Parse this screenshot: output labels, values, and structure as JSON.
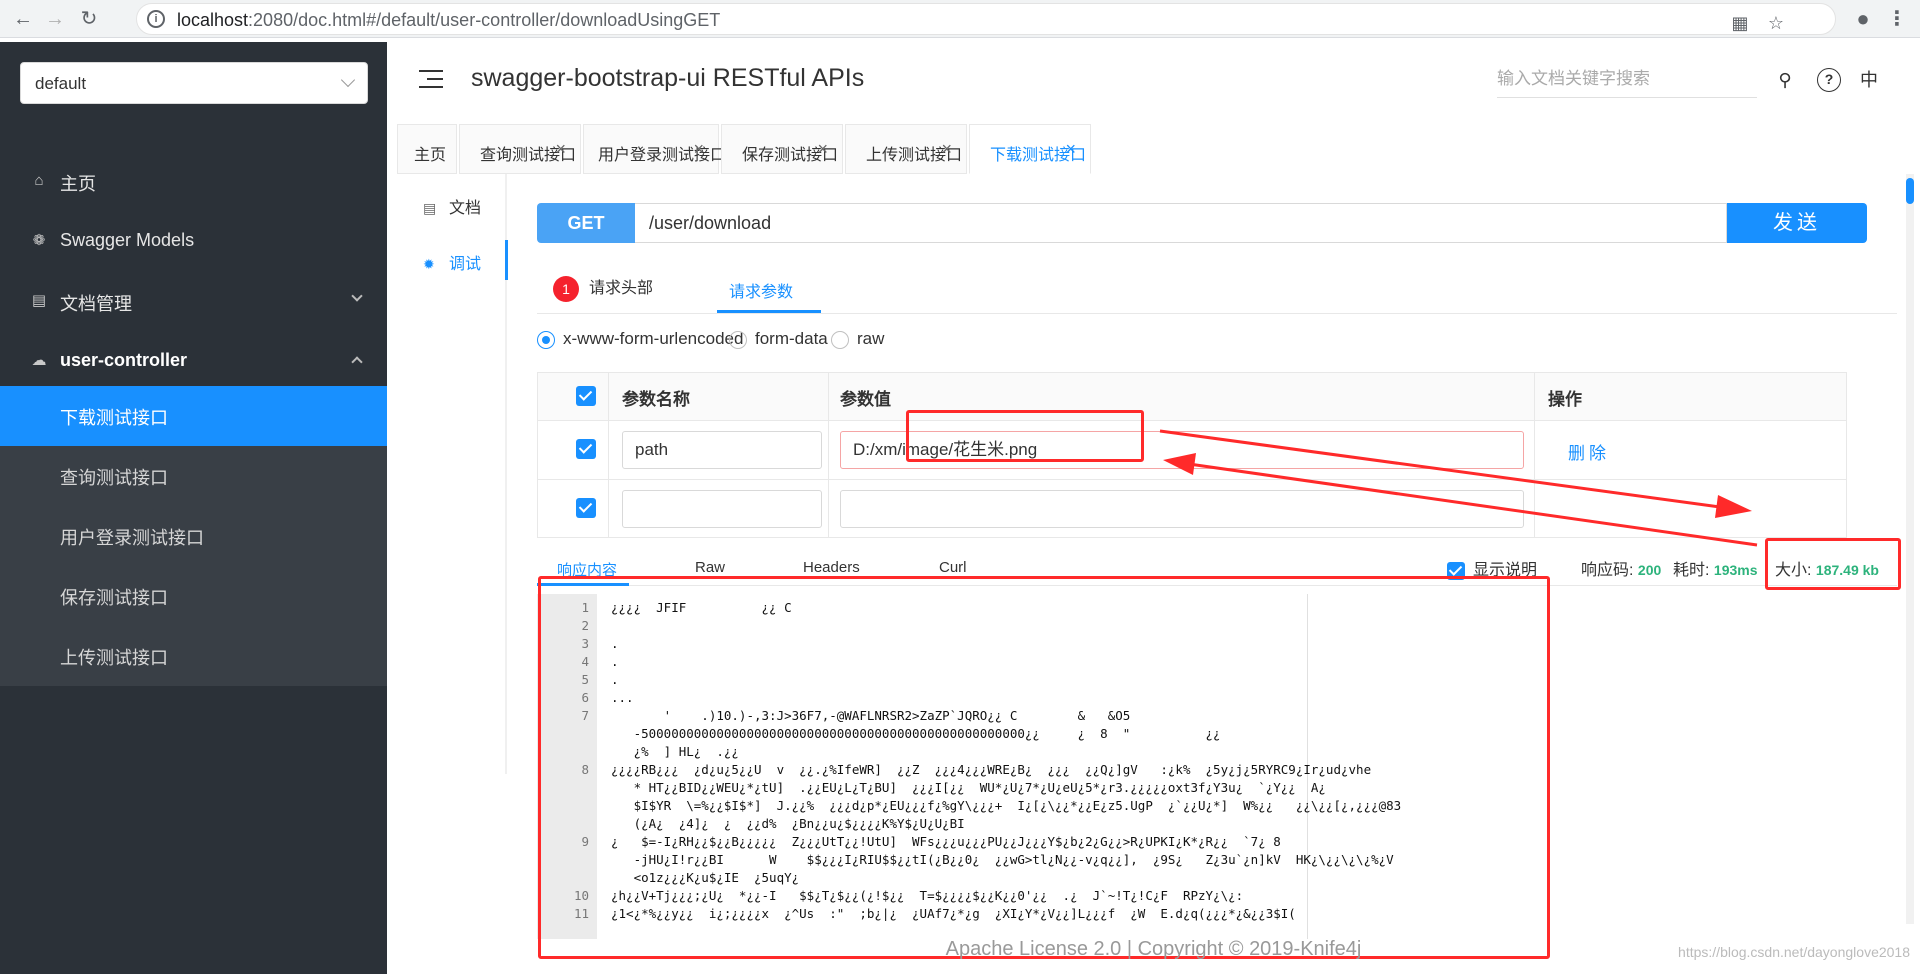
{
  "browser": {
    "url_host": "localhost",
    "url_rest": ":2080/doc.html#/default/user-controller/downloadUsingGET"
  },
  "sidebar": {
    "group_select": "default",
    "items": [
      {
        "label": "主页",
        "icon": "home-icon"
      },
      {
        "label": "Swagger Models",
        "icon": "models-icon"
      },
      {
        "label": "文档管理",
        "icon": "doc-manage-icon"
      },
      {
        "label": "user-controller",
        "icon": "cloud-icon"
      }
    ],
    "sub_items": [
      {
        "label": "下载测试接口",
        "active": true
      },
      {
        "label": "查询测试接口"
      },
      {
        "label": "用户登录测试接口"
      },
      {
        "label": "保存测试接口"
      },
      {
        "label": "上传测试接口"
      }
    ]
  },
  "header": {
    "title": "swagger-bootstrap-ui RESTful APIs",
    "search_placeholder": "输入文档关键字搜索",
    "lang": "中"
  },
  "tabs": [
    {
      "label": "主页"
    },
    {
      "label": "查询测试接口"
    },
    {
      "label": "用户登录测试接口"
    },
    {
      "label": "保存测试接口"
    },
    {
      "label": "上传测试接口"
    },
    {
      "label": "下载测试接口",
      "active": true
    }
  ],
  "doc_nav": {
    "doc": "文档",
    "debug": "调试"
  },
  "request": {
    "method": "GET",
    "url": "/user/download",
    "send": "发送",
    "header_tab": "请求头部",
    "header_count": "1",
    "params_tab": "请求参数",
    "content_types": [
      "x-www-form-urlencoded",
      "form-data",
      "raw"
    ],
    "table": {
      "col_name": "参数名称",
      "col_value": "参数值",
      "col_op": "操作",
      "rows": [
        {
          "name": "path",
          "value": "D:/xm/image/花生米.png",
          "op": "删除"
        },
        {
          "name": "",
          "value": "",
          "op": ""
        }
      ]
    }
  },
  "response": {
    "tabs": [
      "响应内容",
      "Raw",
      "Headers",
      "Curl"
    ],
    "show_desc": "显示说明",
    "code_label": "响应码:",
    "code": "200",
    "time_label": "耗时:",
    "time": "193ms",
    "size_label": "大小:",
    "size": "187.49 kb",
    "lines": [
      {
        "n": "1",
        "t": "¿¿¿¿  JFIF          ¿¿ C"
      },
      {
        "n": "2",
        "t": ""
      },
      {
        "n": "3",
        "t": "."
      },
      {
        "n": "4",
        "t": "."
      },
      {
        "n": "5",
        "t": "."
      },
      {
        "n": "6",
        "t": "..."
      },
      {
        "n": "7",
        "t": "       '    .)10.)-,3:J>36F7,-@WAFLNRSR2>ZaZP`JQRO¿¿ C        &   &O5"
      },
      {
        "n": "",
        "t": "   -500000000000000000000000000000000000000000000000000¿¿     ¿  8  \"          ¿¿"
      },
      {
        "n": "",
        "t": "   ¿%  ] HL¿  .¿¿"
      },
      {
        "n": "8",
        "t": "¿¿¿¿RB¿¿¿  ¿d¿u¿5¿¿U  v  ¿¿.¿%IfeWR]  ¿¿Z  ¿¿¿4¿¿¿WRE¿B¿  ¿¿¿  ¿¿Q¿]gV   :¿k%  ¿5y¿j¿5RYRC9¿Ir¿ud¿vhe"
      },
      {
        "n": "",
        "t": "   * HT¿¿BID¿¿WEU¿*¿tU]  .¿¿EU¿L¿T¿BU]  ¿¿¿I[¿¿  WU*¿U¿7*¿U¿eU¿5*¿r3.¿¿¿¿¿oxt3f¿Y3u¿  `¿Y¿¿  A¿"
      },
      {
        "n": "",
        "t": "   $I$YR  \\=%¿¿$I$*]  J.¿¿%  ¿¿¿d¿p*¿EU¿¿¿f¿%gY\\¿¿¿+  I¿[¿\\¿¿*¿¿E¿z5.UgP  ¿`¿¿U¿*]  W%¿¿   ¿¿\\¿¿[¿,¿¿¿@83"
      },
      {
        "n": "",
        "t": "   (¿A¿  ¿4]¿  ¿  ¿¿d%  ¿Bn¿¿u¿$¿¿¿¿K%Y$¿U¿U¿BI"
      },
      {
        "n": "9",
        "t": "¿   $=-I¿RH¿¿$¿¿B¿¿¿¿¿  Z¿¿¿UtT¿¿!UtU]  WFs¿¿¿u¿¿¿PU¿¿J¿¿¿Y$¿b¿2¿G¿¿>R¿UPKI¿K*¿R¿¿  `7¿ 8"
      },
      {
        "n": "",
        "t": "   -jHU¿I!r¿¿BI      W    $$¿¿¿I¿RIU$$¿¿tI(¿B¿¿0¿  ¿¿wG>tl¿N¿¿-v¿q¿¿],  ¿9S¿   Z¿3u`¿n]kV  HK¿\\¿¿\\¿\\¿%¿V"
      },
      {
        "n": "",
        "t": "   <o1z¿¿¿K¿u$¿IE  ¿5uqY¿"
      },
      {
        "n": "10",
        "t": "¿h¿¿V+Tj¿¿¿;¿U¿  *¿¿-I   $$¿T¿$¿¿(¿!$¿¿  T=$¿¿¿¿$¿¿K¿¿0'¿¿  .¿  J`~!T¿!C¿F  RPzY¿\\¿:"
      },
      {
        "n": "11",
        "t": "¿1<¿*%¿¿y¿¿  i¿;¿¿¿¿x  ¿^Us  :\"  ;b¿|¿  ¿UAf7¿*¿g  ¿XI¿Y*¿V¿¿]L¿¿¿f  ¿W  E.d¿q(¿¿¿*¿&¿¿3$I("
      }
    ]
  },
  "footer": {
    "text": "Apache License 2.0 | Copyright © 2019-Knife4j",
    "watermark": "https://blog.csdn.net/dayonglove2018"
  }
}
